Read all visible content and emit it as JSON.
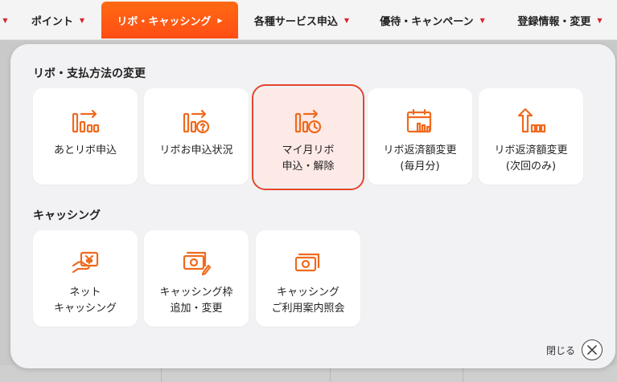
{
  "nav": {
    "items": [
      {
        "label": "ポイント",
        "active": false
      },
      {
        "label": "リボ・キャッシング",
        "active": true
      },
      {
        "label": "各種サービス申込",
        "active": false
      },
      {
        "label": "優待・キャンペーン",
        "active": false
      },
      {
        "label": "登録情報・変更",
        "active": false
      }
    ],
    "accent_color": "#ff5a14",
    "caret_color": "#d9232e"
  },
  "panel": {
    "section1": {
      "title": "リボ・支払方法の変更",
      "cards": [
        {
          "label": "あとリボ申込",
          "icon": "bar-chart-arrow-icon"
        },
        {
          "label": "リボお申込状況",
          "icon": "bar-chart-question-icon"
        },
        {
          "label": "マイ月リボ\n申込・解除",
          "icon": "bar-chart-clock-icon",
          "selected": true
        },
        {
          "label": "リボ返済額変更\n(毎月分)",
          "icon": "calendar-bars-icon"
        },
        {
          "label": "リボ返済額変更\n(次回のみ)",
          "icon": "arrow-up-bars-icon"
        }
      ]
    },
    "section2": {
      "title": "キャッシング",
      "cards": [
        {
          "label": "ネット\nキャッシング",
          "icon": "hand-yen-icon"
        },
        {
          "label": "キャッシング枠\n追加・変更",
          "icon": "money-pencil-icon"
        },
        {
          "label": "キャッシング\nご利用案内照会",
          "icon": "money-search-icon"
        }
      ]
    },
    "close_label": "閉じる"
  },
  "colors": {
    "icon_orange": "#ef6a1e",
    "selected_outline": "#e8442a",
    "selected_bg": "#fde9e6"
  }
}
